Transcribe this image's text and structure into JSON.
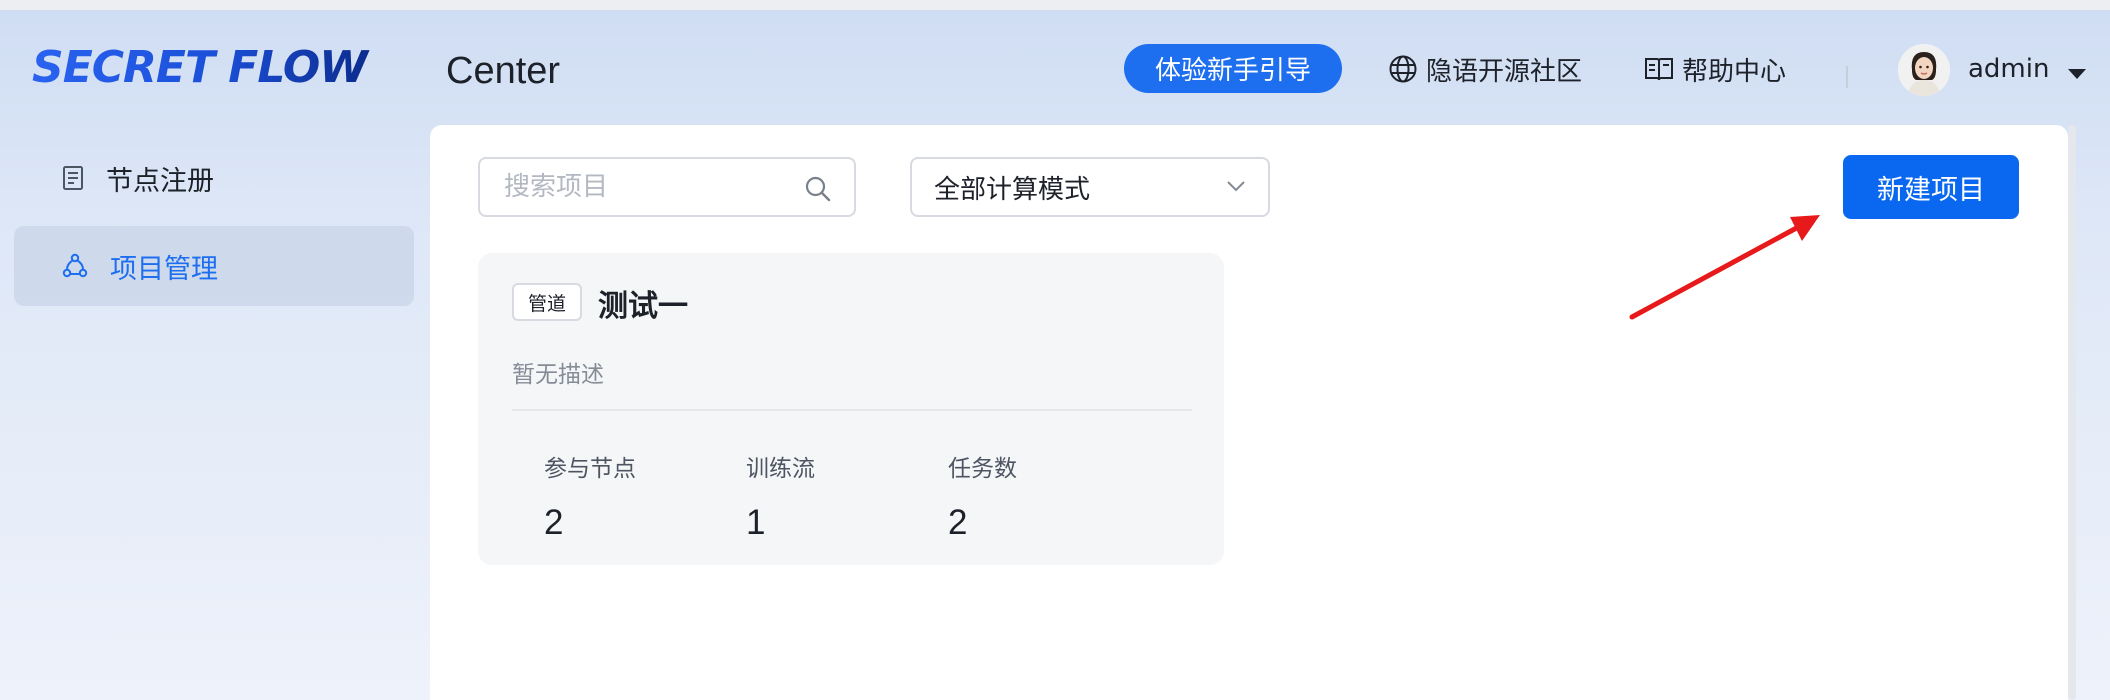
{
  "header": {
    "logo_text": "SECRET FLOW",
    "title": "Center",
    "guide_button": "体验新手引导",
    "community_link": "隐语开源社区",
    "help_link": "帮助中心",
    "username": "admin",
    "icons": {
      "community": "globe-icon",
      "help": "book-icon",
      "user_menu": "caret-down-icon"
    }
  },
  "sidebar": {
    "items": [
      {
        "label": "节点注册",
        "icon": "document-icon",
        "active": false
      },
      {
        "label": "项目管理",
        "icon": "network-icon",
        "active": true
      }
    ]
  },
  "toolbar": {
    "search_placeholder": "搜索项目",
    "mode_select_value": "全部计算模式",
    "new_project_button": "新建项目"
  },
  "projects": [
    {
      "badge": "管道",
      "title": "测试一",
      "description": "暂无描述",
      "stats": [
        {
          "label": "参与节点",
          "value": "2"
        },
        {
          "label": "训练流",
          "value": "1"
        },
        {
          "label": "任务数",
          "value": "2"
        }
      ]
    }
  ],
  "colors": {
    "primary": "#0a68f0",
    "annotation_arrow": "#e8191a"
  }
}
